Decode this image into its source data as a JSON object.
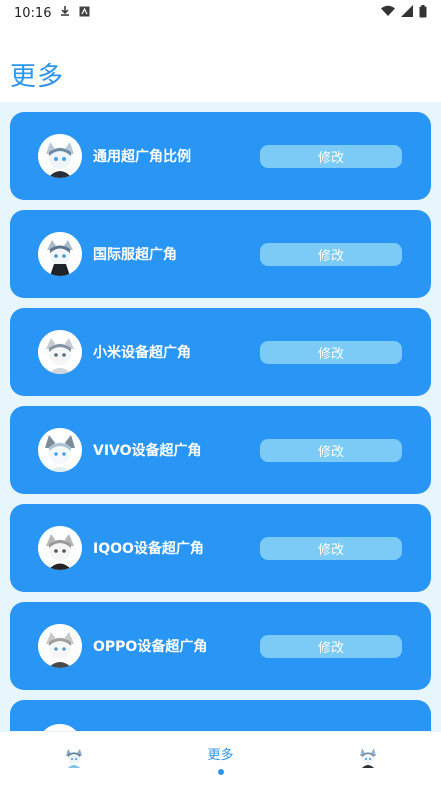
{
  "status_bar": {
    "time": "10:16"
  },
  "page": {
    "title": "更多"
  },
  "items": [
    {
      "label": "通用超广角比例",
      "button": "修改"
    },
    {
      "label": "国际服超广角",
      "button": "修改"
    },
    {
      "label": "小米设备超广角",
      "button": "修改"
    },
    {
      "label": "VIVO设备超广角",
      "button": "修改"
    },
    {
      "label": "IQOO设备超广角",
      "button": "修改"
    },
    {
      "label": "OPPO设备超广角",
      "button": "修改"
    }
  ],
  "bottom_nav": {
    "active_label": "更多"
  },
  "colors": {
    "accent": "#2e94e8",
    "card": "#2996f5",
    "button": "#7ccaf6",
    "content_bg": "#e7f6fd"
  }
}
